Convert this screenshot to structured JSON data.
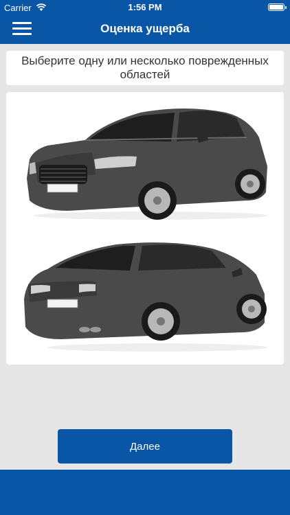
{
  "status_bar": {
    "carrier": "Carrier",
    "time": "1:56 PM",
    "battery_level": 1.0
  },
  "navbar": {
    "title": "Оценка ущерба",
    "menu_icon": "hamburger-menu-icon"
  },
  "instruction": {
    "text": "Выберите одну или несколько поврежденных областей"
  },
  "car_views": [
    {
      "name": "front-three-quarter",
      "plate": ""
    },
    {
      "name": "rear-three-quarter",
      "plate": ""
    }
  ],
  "actions": {
    "next_label": "Далее"
  },
  "colors": {
    "accent": "#0a56a6",
    "background": "#e6e6e6",
    "car_body": "#4a4a4a"
  }
}
